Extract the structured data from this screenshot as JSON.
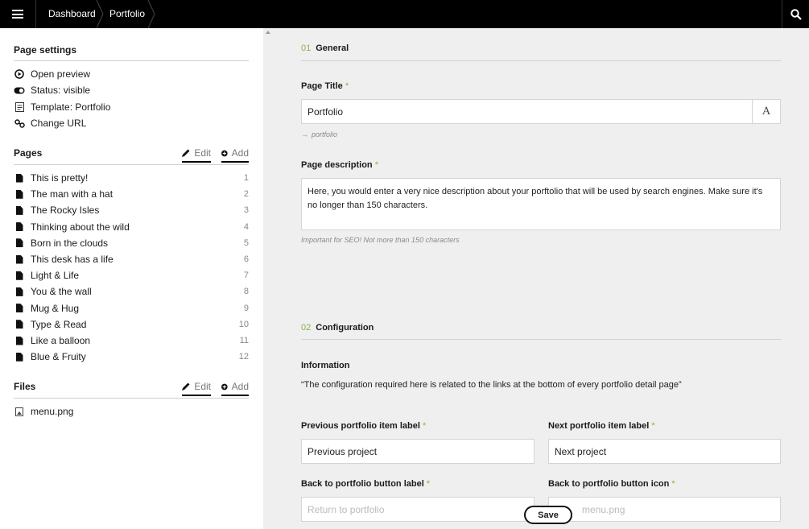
{
  "topbar": {
    "breadcrumbs": [
      "Dashboard",
      "Portfolio"
    ]
  },
  "sidebar": {
    "page_settings": {
      "title": "Page settings",
      "items": [
        {
          "label": "Open preview",
          "icon": "play-circle-icon"
        },
        {
          "label": "Status: visible",
          "icon": "toggle-icon"
        },
        {
          "label": "Template: Portfolio",
          "icon": "template-icon"
        },
        {
          "label": "Change URL",
          "icon": "link-icon"
        }
      ]
    },
    "pages": {
      "title": "Pages",
      "edit_label": "Edit",
      "add_label": "Add",
      "items": [
        {
          "label": "This is pretty!",
          "num": "1"
        },
        {
          "label": "The man with a hat",
          "num": "2"
        },
        {
          "label": "The Rocky Isles",
          "num": "3"
        },
        {
          "label": "Thinking about the wild",
          "num": "4"
        },
        {
          "label": "Born in the clouds",
          "num": "5"
        },
        {
          "label": "This desk has a life",
          "num": "6"
        },
        {
          "label": "Light & Life",
          "num": "7"
        },
        {
          "label": "You & the wall",
          "num": "8"
        },
        {
          "label": "Mug & Hug",
          "num": "9"
        },
        {
          "label": "Type & Read",
          "num": "10"
        },
        {
          "label": "Like a balloon",
          "num": "11"
        },
        {
          "label": "Blue & Fruity",
          "num": "12"
        }
      ]
    },
    "files": {
      "title": "Files",
      "edit_label": "Edit",
      "add_label": "Add",
      "items": [
        {
          "label": "menu.png"
        }
      ]
    }
  },
  "main": {
    "general": {
      "num": "01",
      "title": "General",
      "page_title_label": "Page Title",
      "page_title_value": "Portfolio",
      "slug": "portfolio",
      "description_label": "Page description",
      "description_value": "Here, you would enter a very nice description about your porftolio that will be used by search engines. Make sure it's no longer than 150 characters.",
      "description_hint": "Important for SEO! Not more than 150 characters"
    },
    "configuration": {
      "num": "02",
      "title": "Configuration",
      "info_label": "Information",
      "info_text": "“The configuration required here is related to the links at the bottom of every portfolio detail page”",
      "prev_label": "Previous portfolio item label",
      "prev_value": "Previous project",
      "next_label": "Next portfolio item label",
      "next_value": "Next project",
      "back_label": "Back to portfolio button label",
      "back_value": "Return to portfolio",
      "back_icon_label": "Back to portfolio button icon",
      "back_icon_value": "menu.png"
    },
    "required_mark": "*",
    "save_label": "Save"
  },
  "colors": {
    "accent": "#8ab14a",
    "topbar": "#000000"
  }
}
